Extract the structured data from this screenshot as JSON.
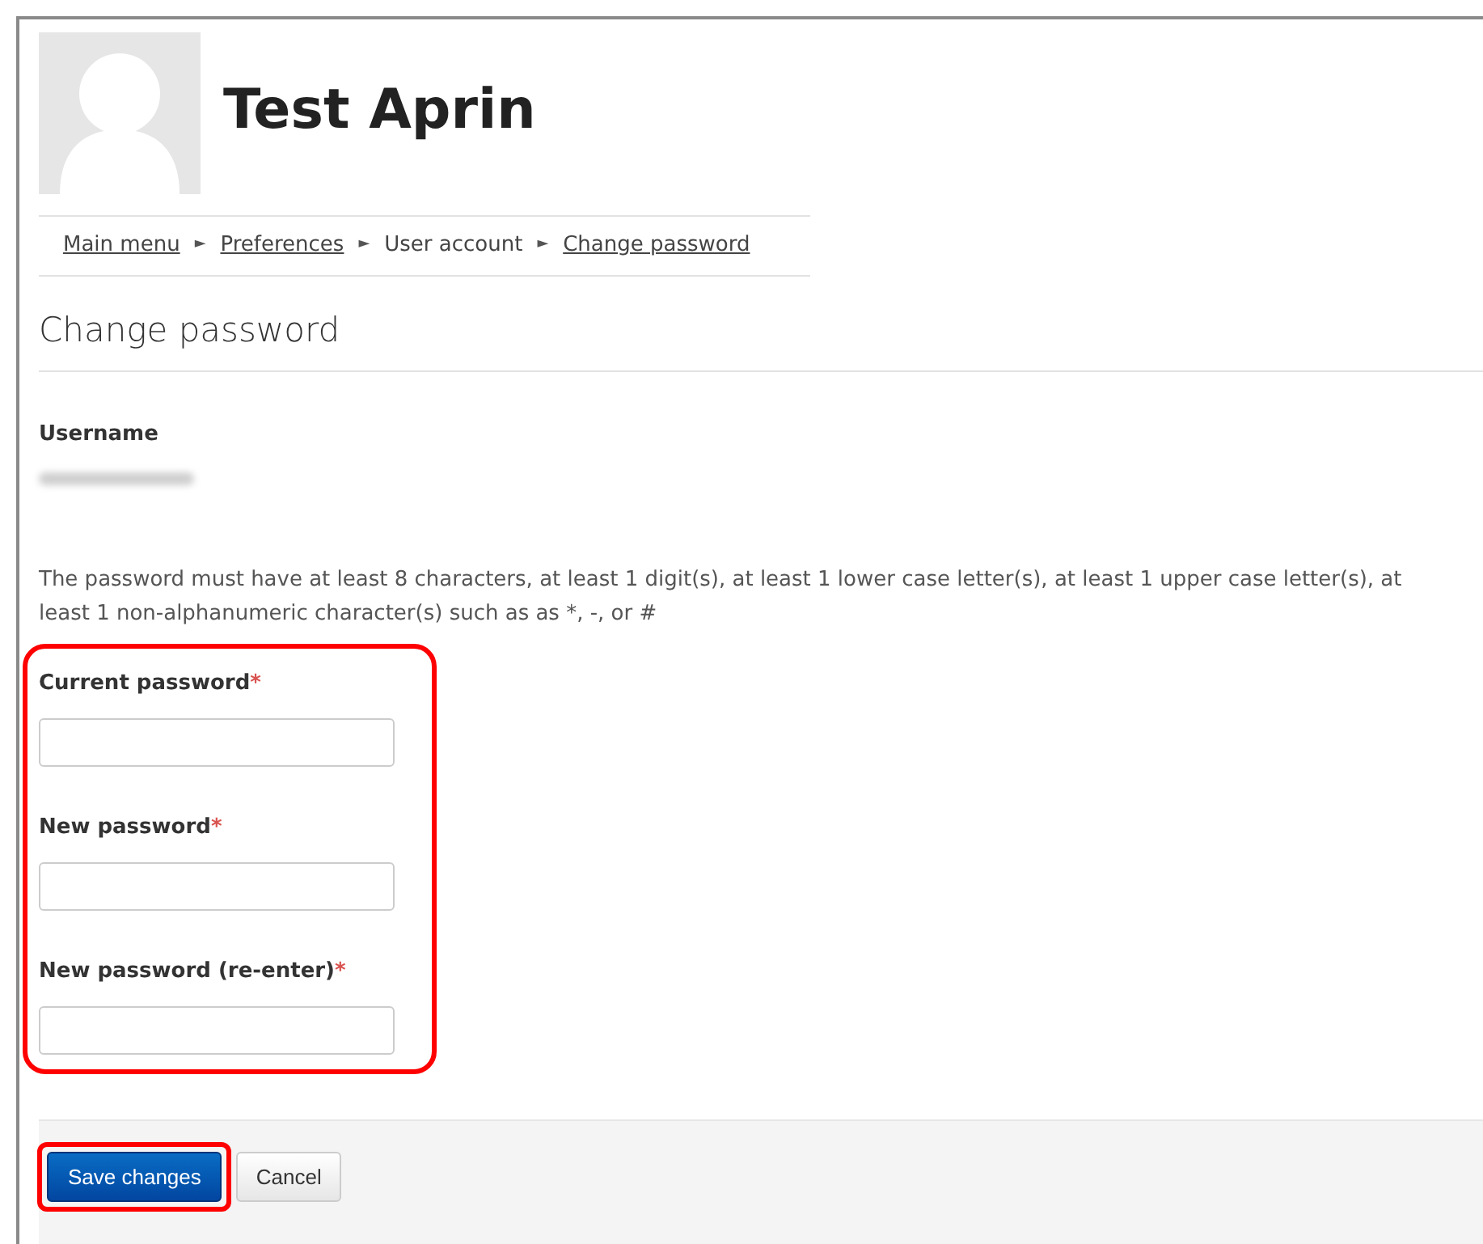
{
  "profile": {
    "name": "Test Aprin"
  },
  "breadcrumb": [
    {
      "label": "Main menu",
      "link": true
    },
    {
      "label": "Preferences",
      "link": true
    },
    {
      "label": "User account",
      "link": false
    },
    {
      "label": "Change password",
      "link": true
    }
  ],
  "breadcrumb_separator": "►",
  "heading": "Change password",
  "username": {
    "label": "Username",
    "value_blurred": true
  },
  "policy": "The password must have at least 8 characters, at least 1 digit(s), at least 1 lower case letter(s), at least 1 upper case letter(s), at least 1 non-alphanumeric character(s) such as as *, -, or #",
  "fields_highlighted": true,
  "fields": [
    {
      "label": "Current password",
      "required_mark": "*"
    },
    {
      "label": "New password",
      "required_mark": "*"
    },
    {
      "label": "New password (re-enter)",
      "required_mark": "*"
    }
  ],
  "buttons": [
    {
      "label": "Save changes",
      "kind": "primary",
      "highlighted": true
    },
    {
      "label": "Cancel",
      "kind": "secondary",
      "highlighted": false
    }
  ]
}
